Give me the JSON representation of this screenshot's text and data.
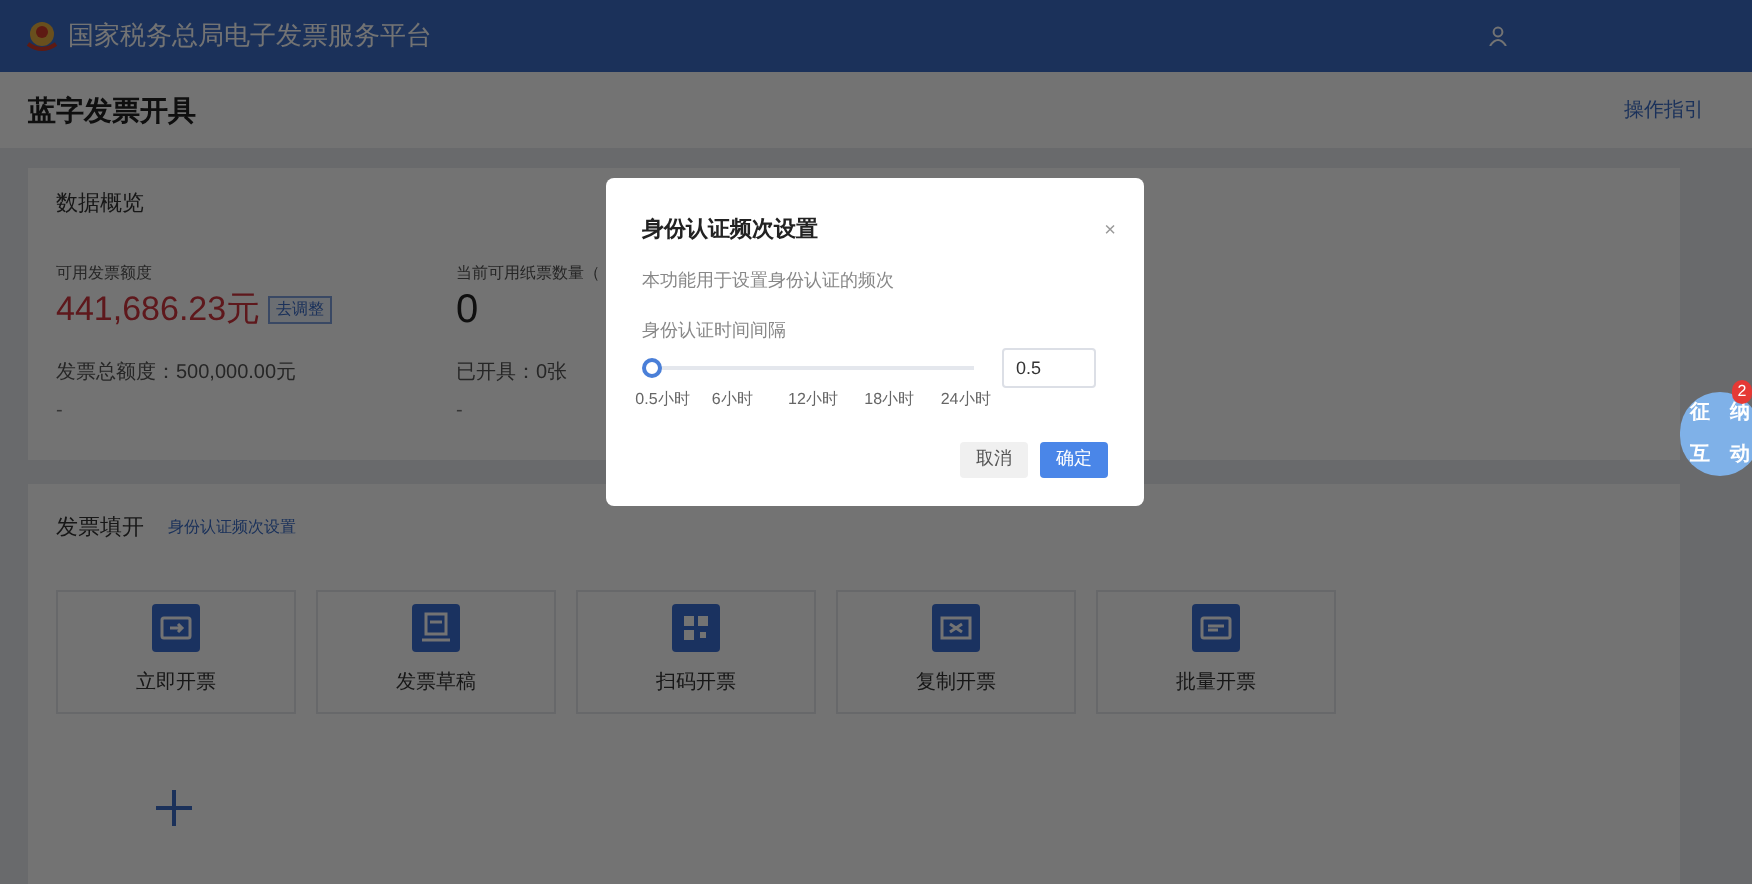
{
  "header": {
    "title": "国家税务总局电子发票服务平台"
  },
  "page": {
    "title": "蓝字发票开具",
    "guide_link": "操作指引"
  },
  "overview": {
    "title": "数据概览",
    "stats": [
      {
        "label": "可用发票额度",
        "value": "441,686.23元",
        "kind": "amount",
        "badge": "去调整",
        "sub_label": "发票总额度：500,000.00元",
        "sub_value": "-"
      },
      {
        "label": "当前可用纸票数量（",
        "value": "0",
        "kind": "count",
        "sub_label": "已开具：0张",
        "sub_value": "-"
      }
    ]
  },
  "issue": {
    "title": "发票填开",
    "link": "身份认证频次设置",
    "tiles": [
      {
        "label": "立即开票"
      },
      {
        "label": "发票草稿"
      },
      {
        "label": "扫码开票"
      },
      {
        "label": "复制开票"
      },
      {
        "label": "批量开票"
      }
    ]
  },
  "dialog": {
    "title": "身份认证频次设置",
    "close": "×",
    "description": "本功能用于设置身份认证的频次",
    "field_label": "身份认证时间间隔",
    "level": 0,
    "ticks": [
      "0.5小时",
      "6小时",
      "12小时",
      "18小时",
      "24小时"
    ],
    "value": "0.5",
    "buttons": [
      {
        "label": "取消",
        "kind": "secondary"
      },
      {
        "label": "确定",
        "kind": "primary"
      }
    ]
  },
  "assistant": {
    "label": "征纳互动",
    "badge": "2"
  }
}
